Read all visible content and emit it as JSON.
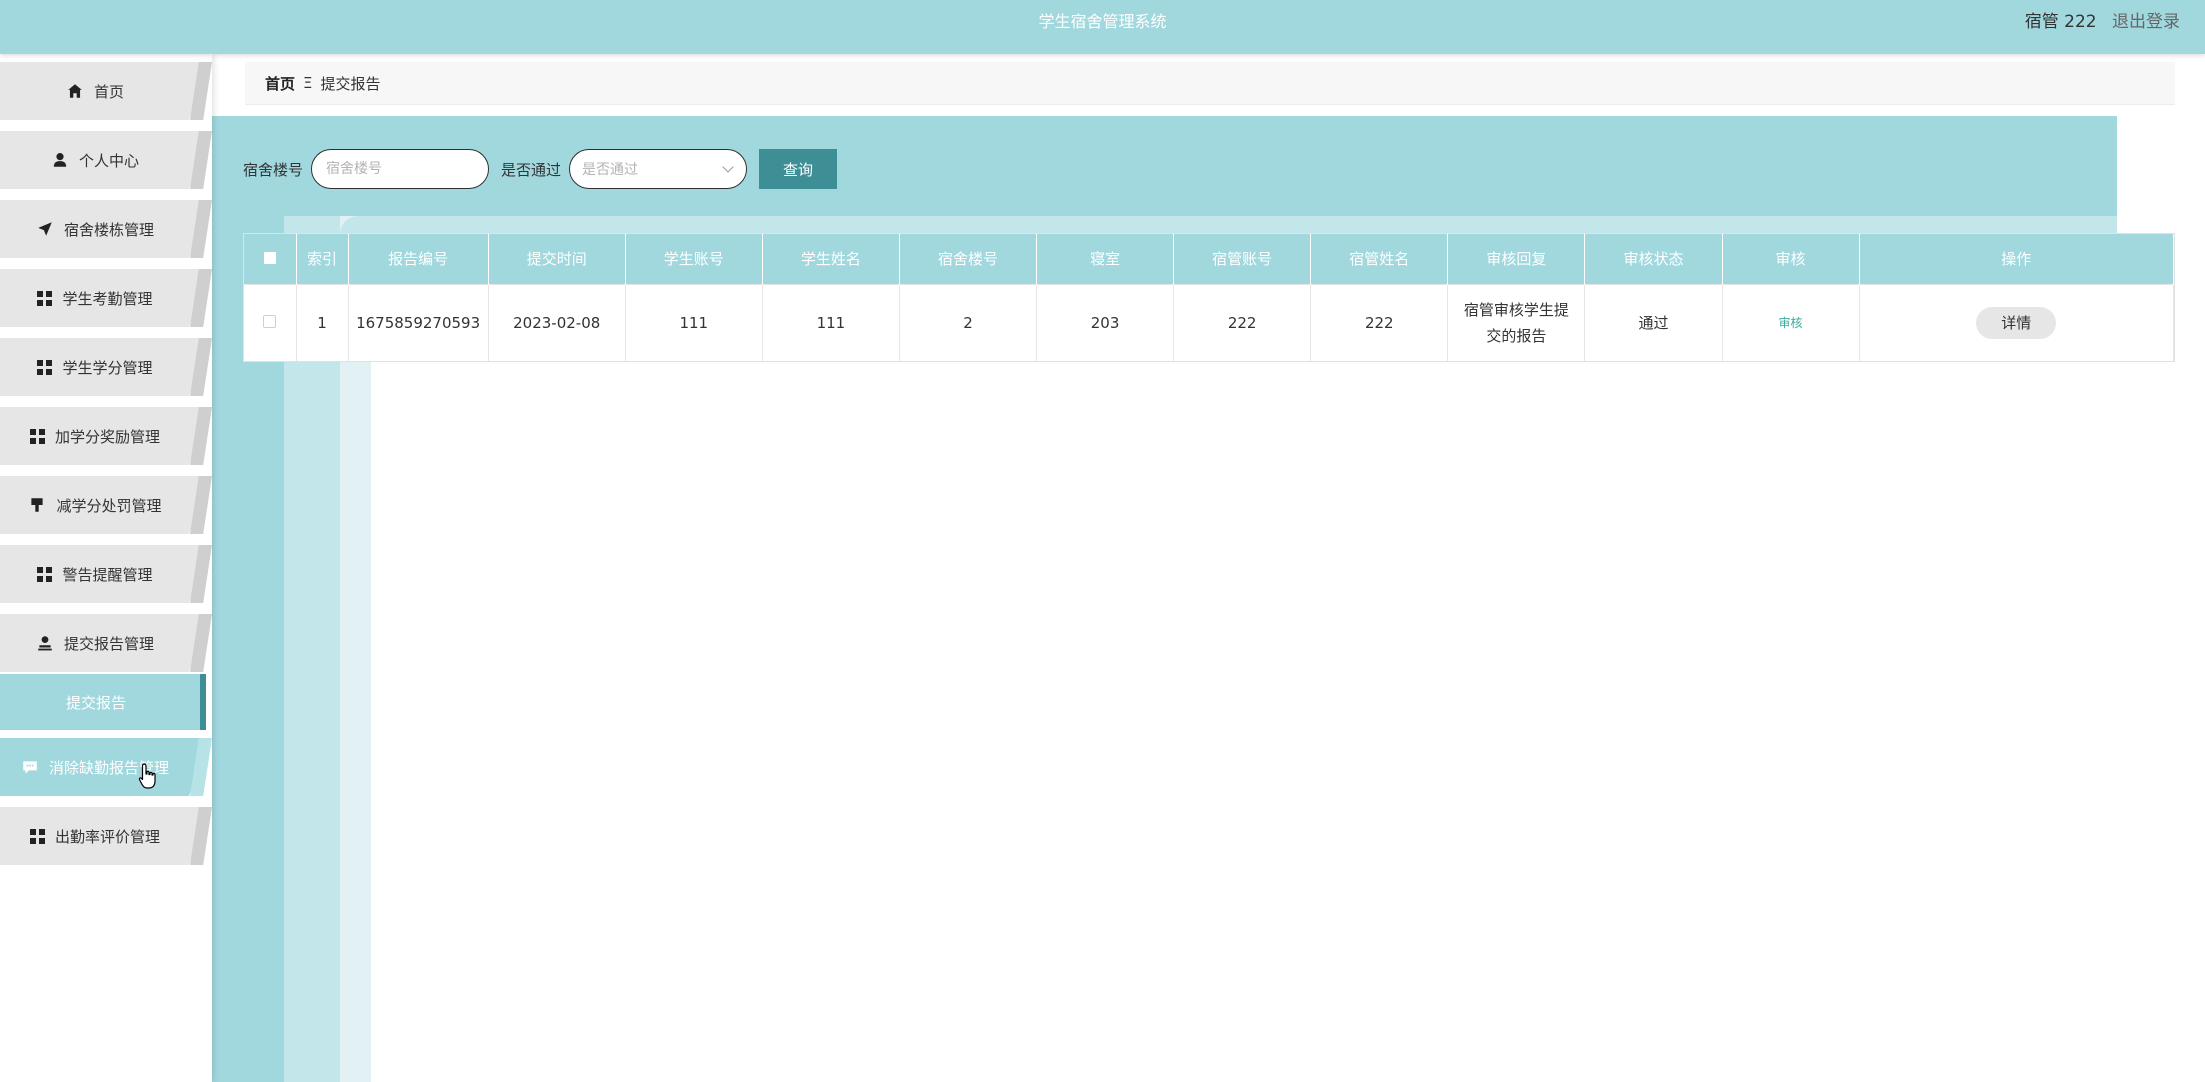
{
  "header": {
    "app_title": "学生宿舍管理系统",
    "user_label": "宿管 222",
    "logout_label": "退出登录"
  },
  "sidebar": {
    "items": [
      {
        "label": "首页",
        "icon": "home-icon"
      },
      {
        "label": "个人中心",
        "icon": "user-icon"
      },
      {
        "label": "宿舍楼栋管理",
        "icon": "send-icon"
      },
      {
        "label": "学生考勤管理",
        "icon": "grid-icon"
      },
      {
        "label": "学生学分管理",
        "icon": "grid-icon"
      },
      {
        "label": "加学分奖励管理",
        "icon": "grid-icon"
      },
      {
        "label": "减学分处罚管理",
        "icon": "brush-icon"
      },
      {
        "label": "警告提醒管理",
        "icon": "grid-icon"
      },
      {
        "label": "提交报告管理",
        "icon": "user-stamp-icon"
      },
      {
        "label": "提交报告",
        "icon": ""
      },
      {
        "label": "消除缺勤报告管理",
        "icon": "chat-icon"
      },
      {
        "label": "出勤率评价管理",
        "icon": "grid-icon"
      }
    ]
  },
  "breadcrumb": {
    "home": "首页",
    "separator": "Ξ",
    "current": "提交报告"
  },
  "search": {
    "dorm_label": "宿舍楼号",
    "dorm_placeholder": "宿舍楼号",
    "pass_label": "是否通过",
    "pass_placeholder": "是否通过",
    "query_button": "查询"
  },
  "table": {
    "headers": [
      "索引",
      "报告编号",
      "提交时间",
      "学生账号",
      "学生姓名",
      "宿舍楼号",
      "寝室",
      "宿管账号",
      "宿管姓名",
      "审核回复",
      "审核状态",
      "审核",
      "操作"
    ],
    "rows": [
      {
        "index": "1",
        "report_no": "1675859270593",
        "submit_time": "2023-02-08",
        "student_account": "111",
        "student_name": "111",
        "dorm_no": "2",
        "room": "203",
        "manager_account": "222",
        "manager_name": "222",
        "reply": "宿管审核学生提交的报告",
        "status": "通过",
        "audit": "审核",
        "action": "详情"
      }
    ]
  },
  "colors": {
    "theme": "#a0d8de",
    "button": "#3e8e96",
    "audit_link": "#3bab9c"
  }
}
